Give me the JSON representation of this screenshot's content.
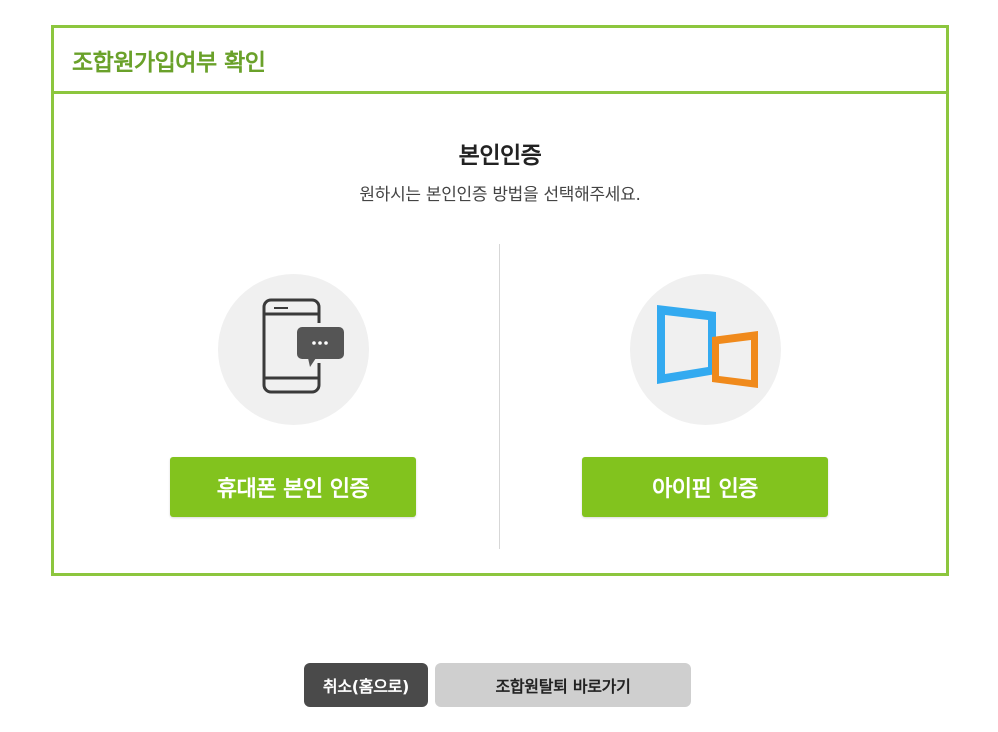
{
  "panel": {
    "title": "조합원가입여부 확인"
  },
  "verification": {
    "title": "본인인증",
    "description": "원하시는 본인인증 방법을 선택해주세요."
  },
  "options": [
    {
      "icon": "mobile-phone-chat-icon",
      "button_label": "휴대폰 본인 인증"
    },
    {
      "icon": "ipin-icon",
      "button_label": "아이핀 인증"
    }
  ],
  "footer": {
    "cancel_label": "취소(홈으로)",
    "withdraw_label": "조합원탈퇴 바로가기"
  },
  "colors": {
    "accent_green": "#8cc63e",
    "button_green": "#82c31e",
    "title_green": "#6aa12a",
    "cancel_dark": "#4a4a4a",
    "withdraw_gray": "#cfcfcf",
    "ipin_blue": "#33aaf0",
    "ipin_orange": "#f08a1c"
  }
}
